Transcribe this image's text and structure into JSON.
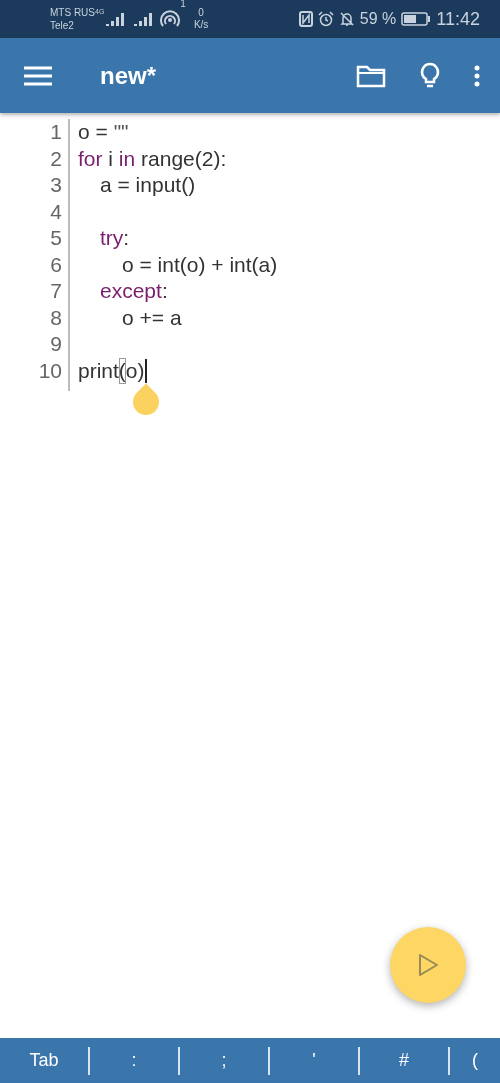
{
  "status_bar": {
    "carriers": [
      "MTS RUS",
      "Tele2"
    ],
    "network": "4G",
    "hotspot_count": "1",
    "speed_value": "0",
    "speed_unit": "K/s",
    "battery": "59 %",
    "time": "11:42"
  },
  "app_bar": {
    "title": "new*"
  },
  "editor": {
    "lines": [
      {
        "number": "1",
        "cursor": false,
        "tokens": [
          {
            "text": "o = ",
            "kind": "plain"
          },
          {
            "text": "\"\"",
            "kind": "string"
          }
        ]
      },
      {
        "number": "2",
        "cursor": false,
        "tokens": [
          {
            "text": "for",
            "kind": "keyword"
          },
          {
            "text": " i ",
            "kind": "plain"
          },
          {
            "text": "in",
            "kind": "keyword"
          },
          {
            "text": " range(2):",
            "kind": "plain"
          }
        ],
        "children": [
          {
            "number": "3",
            "cursor": false,
            "tokens": [
              {
                "text": "a = input()",
                "kind": "plain"
              }
            ]
          },
          {
            "number": "4",
            "cursor": false
          },
          {
            "number": "5",
            "cursor": false,
            "tokens": [
              {
                "text": "try",
                "kind": "keyword"
              },
              {
                "text": ":",
                "kind": "plain"
              }
            ],
            "children": [
              {
                "number": "6",
                "cursor": false,
                "tokens": [
                  {
                    "text": "o = int(o) + int(a)",
                    "kind": "plain"
                  }
                ]
              }
            ]
          },
          {
            "number": "7",
            "cursor": false,
            "tokens": [
              {
                "text": "except",
                "kind": "keyword"
              },
              {
                "text": ":",
                "kind": "plain"
              }
            ],
            "children": [
              {
                "number": "8",
                "cursor": false,
                "tokens": [
                  {
                    "text": "o += a",
                    "kind": "plain"
                  }
                ]
              }
            ]
          }
        ]
      },
      {
        "number": "9",
        "cursor": false
      },
      {
        "number": "10",
        "cursor": true,
        "tokens": [
          {
            "text": "print",
            "kind": "plain"
          },
          {
            "text": "(",
            "kind": "bracket"
          },
          {
            "text": "o)",
            "kind": "plain"
          }
        ]
      }
    ]
  },
  "keys": [
    "Tab",
    ":",
    ";",
    "'",
    "#",
    "("
  ]
}
